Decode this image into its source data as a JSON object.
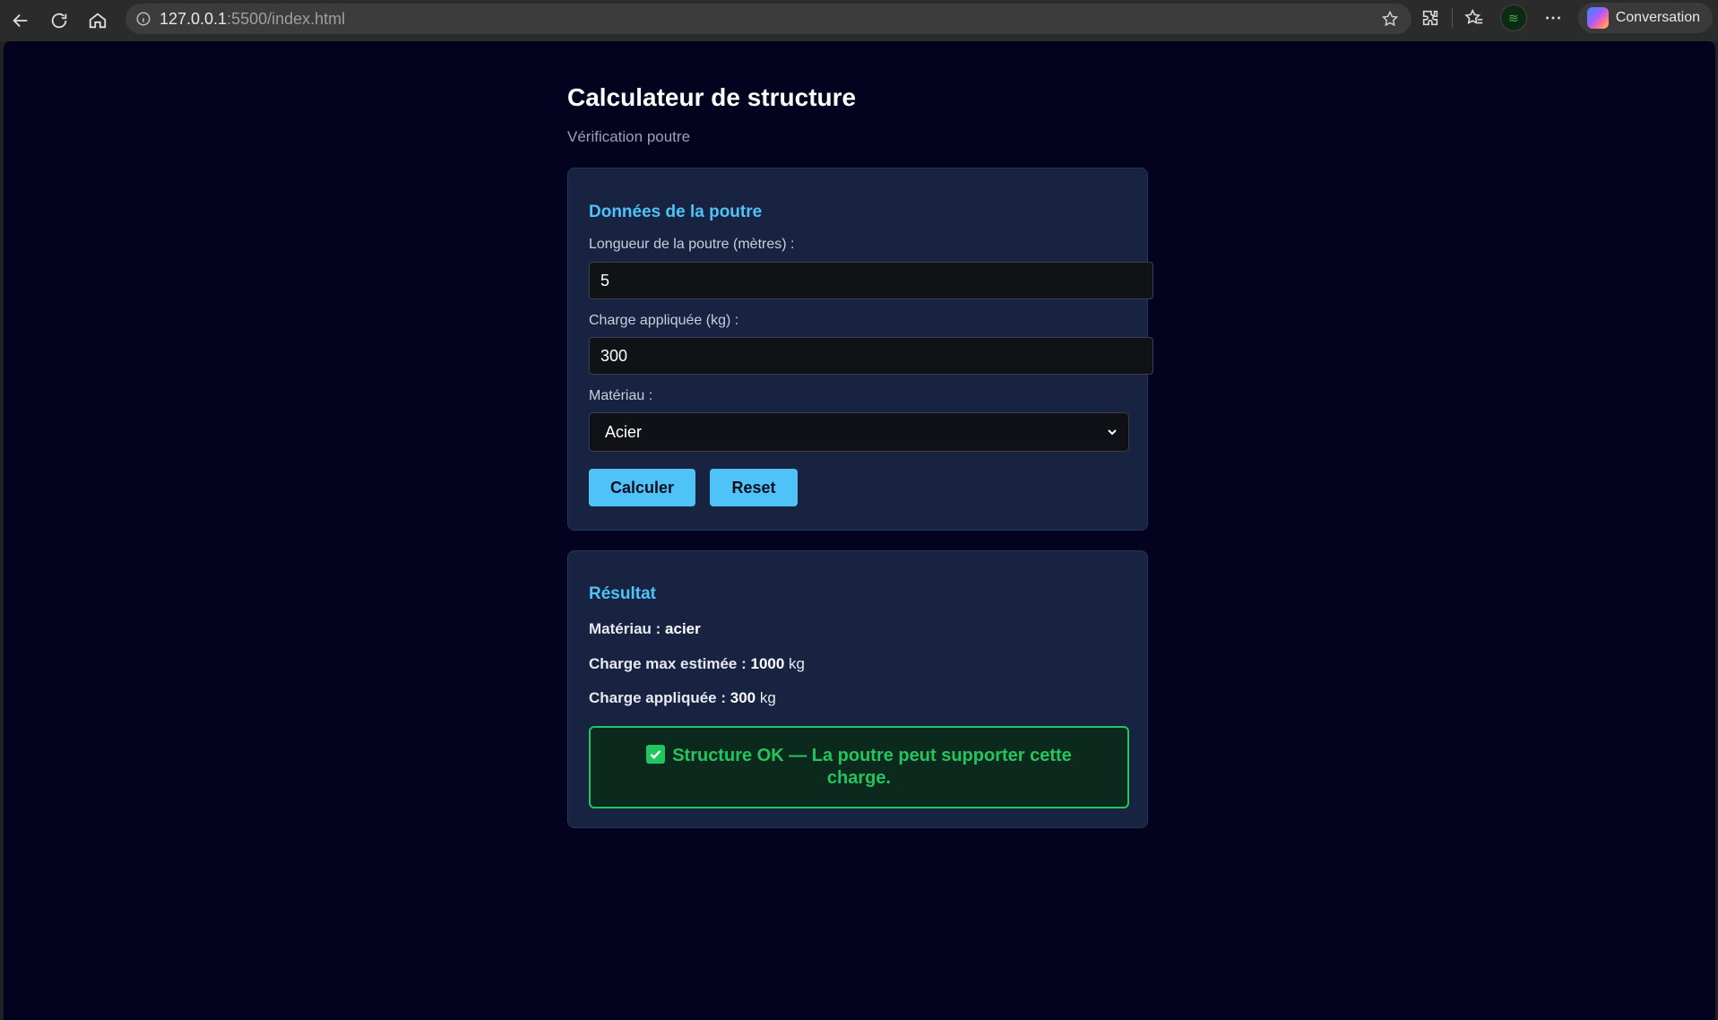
{
  "browser": {
    "url_host": "127.0.0.1",
    "url_rest": ":5500/index.html",
    "conversation_label": "Conversation"
  },
  "page": {
    "title": "Calculateur de structure",
    "subtitle": "Vérification poutre"
  },
  "form": {
    "heading": "Données de la poutre",
    "length_label": "Longueur de la poutre (mètres) :",
    "length_value": "5",
    "load_label": "Charge appliquée (kg) :",
    "load_value": "300",
    "material_label": "Matériau :",
    "material_selected": "Acier",
    "calc_button": "Calculer",
    "reset_button": "Reset"
  },
  "result": {
    "heading": "Résultat",
    "material_label": "Matériau :",
    "material_value": "acier",
    "max_load_label": "Charge max estimée :",
    "max_load_value": "1000",
    "max_load_unit": "kg",
    "applied_label": "Charge appliquée :",
    "applied_value": "300",
    "applied_unit": "kg",
    "status_text": "Structure OK — La poutre peut supporter cette charge."
  },
  "colors": {
    "background": "#03021f",
    "card": "#172341",
    "accent": "#4fc3f7",
    "success": "#22c55e"
  }
}
